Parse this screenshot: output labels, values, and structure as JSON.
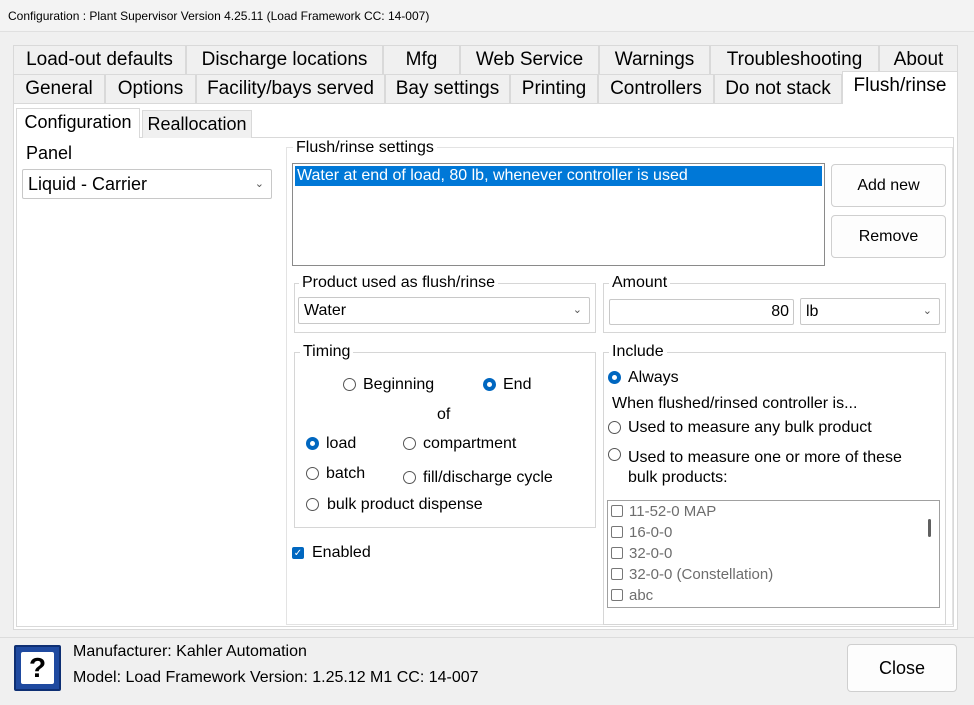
{
  "window": {
    "title": "Configuration : Plant Supervisor Version 4.25.11 (Load Framework CC: 14-007)"
  },
  "tabs_row1": [
    "Load-out defaults",
    "Discharge locations",
    "Mfg",
    "Web Service",
    "Warnings",
    "Troubleshooting",
    "About"
  ],
  "tabs_row2": [
    "General",
    "Options",
    "Facility/bays served",
    "Bay settings",
    "Printing",
    "Controllers",
    "Do not stack",
    "Flush/rinse"
  ],
  "active_tab": "Flush/rinse",
  "subtabs": [
    "Configuration",
    "Reallocation"
  ],
  "active_subtab": "Configuration",
  "panel": {
    "label": "Panel",
    "value": "Liquid - Carrier"
  },
  "flush_settings": {
    "title": "Flush/rinse settings",
    "items": [
      "Water at end of load, 80 lb, whenever controller is used"
    ],
    "add_label": "Add new",
    "remove_label": "Remove"
  },
  "product": {
    "title": "Product used as flush/rinse",
    "value": "Water"
  },
  "amount": {
    "title": "Amount",
    "value": "80",
    "unit": "lb"
  },
  "timing": {
    "title": "Timing",
    "beginning": "Beginning",
    "end": "End",
    "of": "of",
    "load": "load",
    "compartment": "compartment",
    "batch": "batch",
    "cycle": "fill/discharge cycle",
    "dispense": "bulk product dispense",
    "selected_when": "End",
    "selected_of": "load"
  },
  "enabled": {
    "label": "Enabled",
    "checked": true
  },
  "include": {
    "title": "Include",
    "always": "Always",
    "note": "When flushed/rinsed controller is...",
    "any": "Used to measure any bulk product",
    "some_line1": "Used to measure one or more of these",
    "some_line2": "bulk products:",
    "selected": "Always",
    "products": [
      "11-52-0 MAP",
      "16-0-0",
      "32-0-0",
      "32-0-0 (Constellation)",
      "abc"
    ]
  },
  "footer": {
    "manufacturer": "Manufacturer: Kahler Automation",
    "model": "Model: Load Framework Version: 1.25.12 M1 CC: 14-007",
    "close_label": "Close"
  }
}
